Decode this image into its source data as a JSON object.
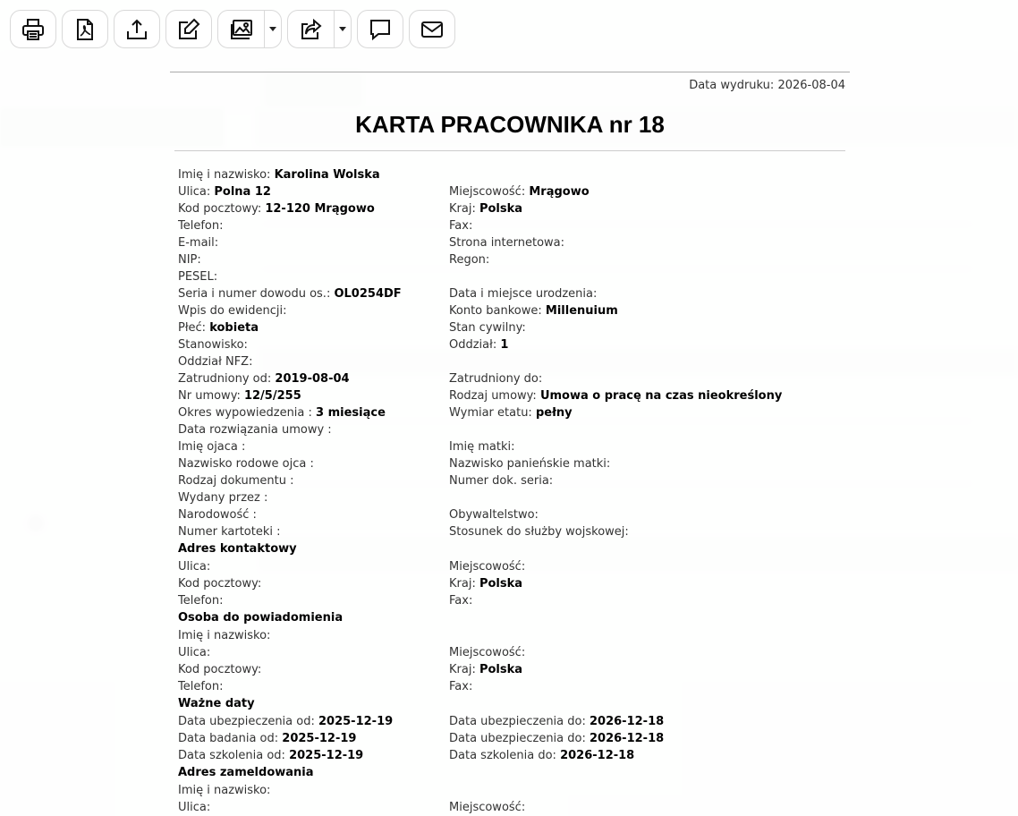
{
  "toolbar": {
    "buttons": [
      {
        "name": "print-icon"
      },
      {
        "name": "pdf-icon"
      },
      {
        "name": "upload-icon"
      },
      {
        "name": "edit-icon"
      },
      {
        "name": "images-icon",
        "split": true
      },
      {
        "name": "share-icon",
        "split": true
      },
      {
        "name": "comment-icon"
      },
      {
        "name": "mail-icon"
      }
    ]
  },
  "header": {
    "print_date_label": "Data wydruku:",
    "print_date": "2026-08-04",
    "title": "KARTA PRACOWNIKA nr 18"
  },
  "rows": [
    {
      "type": "row",
      "left": {
        "label": "Imię i nazwisko:",
        "value": "Karolina Wolska"
      }
    },
    {
      "type": "row",
      "left": {
        "label": "Ulica:",
        "value": "Polna 12"
      },
      "right": {
        "label": "Miejscowość:",
        "value": "Mrągowo"
      }
    },
    {
      "type": "row",
      "left": {
        "label": "Kod pocztowy:",
        "value": "12-120 Mrągowo"
      },
      "right": {
        "label": "Kraj:",
        "value": "Polska"
      }
    },
    {
      "type": "row",
      "left": {
        "label": "Telefon:",
        "value": ""
      },
      "right": {
        "label": "Fax:",
        "value": ""
      }
    },
    {
      "type": "row",
      "left": {
        "label": "E-mail:",
        "value": ""
      },
      "right": {
        "label": "Strona internetowa:",
        "value": ""
      }
    },
    {
      "type": "row",
      "left": {
        "label": "NIP:",
        "value": ""
      },
      "right": {
        "label": "Regon:",
        "value": ""
      }
    },
    {
      "type": "row",
      "left": {
        "label": "PESEL:",
        "value": ""
      }
    },
    {
      "type": "row",
      "left": {
        "label": "Seria i numer dowodu os.:",
        "value": "OL0254DF"
      },
      "right": {
        "label": "Data i miejsce urodzenia:",
        "value": ""
      }
    },
    {
      "type": "row",
      "left": {
        "label": "Wpis do ewidencji:",
        "value": ""
      },
      "right": {
        "label": "Konto bankowe:",
        "value": "Millenuium"
      }
    },
    {
      "type": "row",
      "left": {
        "label": "Płeć:",
        "value": "kobieta"
      },
      "right": {
        "label": "Stan cywilny:",
        "value": ""
      }
    },
    {
      "type": "row",
      "left": {
        "label": "Stanowisko:",
        "value": ""
      },
      "right": {
        "label": "Oddział:",
        "value": "1"
      }
    },
    {
      "type": "row",
      "left": {
        "label": "Oddział NFZ:",
        "value": ""
      }
    },
    {
      "type": "row",
      "left": {
        "label": "Zatrudniony od:",
        "value": "2019-08-04"
      },
      "right": {
        "label": "Zatrudniony do:",
        "value": ""
      }
    },
    {
      "type": "row",
      "left": {
        "label": "Nr umowy:",
        "value": "12/5/255"
      },
      "right": {
        "label": "Rodzaj umowy:",
        "value": "Umowa o pracę na czas nieokreślony"
      }
    },
    {
      "type": "row",
      "left": {
        "label": "Okres wypowiedzenia :",
        "value": "3 miesiące"
      },
      "right": {
        "label": "Wymiar etatu:",
        "value": "pełny"
      }
    },
    {
      "type": "row",
      "left": {
        "label": "Data rozwiązania umowy :",
        "value": ""
      }
    },
    {
      "type": "row",
      "left": {
        "label": "Imię ojaca :",
        "value": ""
      },
      "right": {
        "label": "Imię matki:",
        "value": ""
      }
    },
    {
      "type": "row",
      "left": {
        "label": "Nazwisko rodowe ojca :",
        "value": ""
      },
      "right": {
        "label": "Nazwisko panieńskie matki:",
        "value": ""
      }
    },
    {
      "type": "row",
      "left": {
        "label": "Rodzaj dokumentu :",
        "value": ""
      },
      "right": {
        "label": "Numer dok. seria:",
        "value": ""
      }
    },
    {
      "type": "row",
      "left": {
        "label": "Wydany przez :",
        "value": ""
      }
    },
    {
      "type": "row",
      "left": {
        "label": "Narodowość :",
        "value": ""
      },
      "right": {
        "label": "Obywaltelstwo:",
        "value": ""
      }
    },
    {
      "type": "row",
      "left": {
        "label": "Numer kartoteki :",
        "value": ""
      },
      "right": {
        "label": "Stosunek do służby wojskowej:",
        "value": ""
      }
    },
    {
      "type": "section",
      "title": "Adres kontaktowy"
    },
    {
      "type": "row",
      "left": {
        "label": "Ulica:",
        "value": ""
      },
      "right": {
        "label": "Miejscowość:",
        "value": ""
      }
    },
    {
      "type": "row",
      "left": {
        "label": "Kod pocztowy:",
        "value": ""
      },
      "right": {
        "label": "Kraj:",
        "value": "Polska"
      }
    },
    {
      "type": "row",
      "left": {
        "label": "Telefon:",
        "value": ""
      },
      "right": {
        "label": "Fax:",
        "value": ""
      }
    },
    {
      "type": "section",
      "title": "Osoba do powiadomienia"
    },
    {
      "type": "row",
      "left": {
        "label": "Imię i nazwisko:",
        "value": ""
      }
    },
    {
      "type": "row",
      "left": {
        "label": "Ulica:",
        "value": ""
      },
      "right": {
        "label": "Miejscowość:",
        "value": ""
      }
    },
    {
      "type": "row",
      "left": {
        "label": "Kod pocztowy:",
        "value": ""
      },
      "right": {
        "label": "Kraj:",
        "value": "Polska"
      }
    },
    {
      "type": "row",
      "left": {
        "label": "Telefon:",
        "value": ""
      },
      "right": {
        "label": "Fax:",
        "value": ""
      }
    },
    {
      "type": "section",
      "title": "Ważne daty"
    },
    {
      "type": "row",
      "left": {
        "label": "Data ubezpieczenia od:",
        "value": "2025-12-19"
      },
      "right": {
        "label": "Data ubezpieczenia do:",
        "value": "2026-12-18"
      }
    },
    {
      "type": "row",
      "left": {
        "label": "Data badania od:",
        "value": "2025-12-19"
      },
      "right": {
        "label": "Data ubezpieczenia do:",
        "value": "2026-12-18"
      }
    },
    {
      "type": "row",
      "left": {
        "label": "Data szkolenia od:",
        "value": "2025-12-19"
      },
      "right": {
        "label": "Data szkolenia do:",
        "value": "2026-12-18"
      }
    },
    {
      "type": "section",
      "title": "Adres zameldowania"
    },
    {
      "type": "row",
      "left": {
        "label": "Imię i nazwisko:",
        "value": ""
      }
    },
    {
      "type": "row",
      "left": {
        "label": "Ulica:",
        "value": ""
      },
      "right": {
        "label": "Miejscowość:",
        "value": ""
      }
    }
  ]
}
